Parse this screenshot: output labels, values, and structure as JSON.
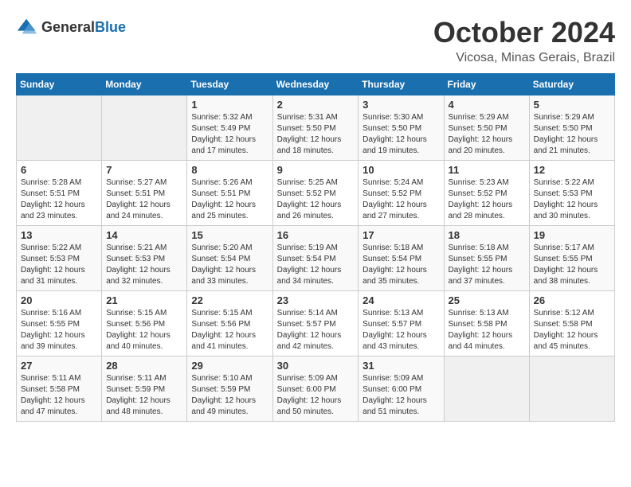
{
  "logo": {
    "general": "General",
    "blue": "Blue"
  },
  "title": {
    "month": "October 2024",
    "location": "Vicosa, Minas Gerais, Brazil"
  },
  "weekdays": [
    "Sunday",
    "Monday",
    "Tuesday",
    "Wednesday",
    "Thursday",
    "Friday",
    "Saturday"
  ],
  "weeks": [
    [
      {
        "day": "",
        "info": ""
      },
      {
        "day": "",
        "info": ""
      },
      {
        "day": "1",
        "info": "Sunrise: 5:32 AM\nSunset: 5:49 PM\nDaylight: 12 hours and 17 minutes."
      },
      {
        "day": "2",
        "info": "Sunrise: 5:31 AM\nSunset: 5:50 PM\nDaylight: 12 hours and 18 minutes."
      },
      {
        "day": "3",
        "info": "Sunrise: 5:30 AM\nSunset: 5:50 PM\nDaylight: 12 hours and 19 minutes."
      },
      {
        "day": "4",
        "info": "Sunrise: 5:29 AM\nSunset: 5:50 PM\nDaylight: 12 hours and 20 minutes."
      },
      {
        "day": "5",
        "info": "Sunrise: 5:29 AM\nSunset: 5:50 PM\nDaylight: 12 hours and 21 minutes."
      }
    ],
    [
      {
        "day": "6",
        "info": "Sunrise: 5:28 AM\nSunset: 5:51 PM\nDaylight: 12 hours and 23 minutes."
      },
      {
        "day": "7",
        "info": "Sunrise: 5:27 AM\nSunset: 5:51 PM\nDaylight: 12 hours and 24 minutes."
      },
      {
        "day": "8",
        "info": "Sunrise: 5:26 AM\nSunset: 5:51 PM\nDaylight: 12 hours and 25 minutes."
      },
      {
        "day": "9",
        "info": "Sunrise: 5:25 AM\nSunset: 5:52 PM\nDaylight: 12 hours and 26 minutes."
      },
      {
        "day": "10",
        "info": "Sunrise: 5:24 AM\nSunset: 5:52 PM\nDaylight: 12 hours and 27 minutes."
      },
      {
        "day": "11",
        "info": "Sunrise: 5:23 AM\nSunset: 5:52 PM\nDaylight: 12 hours and 28 minutes."
      },
      {
        "day": "12",
        "info": "Sunrise: 5:22 AM\nSunset: 5:53 PM\nDaylight: 12 hours and 30 minutes."
      }
    ],
    [
      {
        "day": "13",
        "info": "Sunrise: 5:22 AM\nSunset: 5:53 PM\nDaylight: 12 hours and 31 minutes."
      },
      {
        "day": "14",
        "info": "Sunrise: 5:21 AM\nSunset: 5:53 PM\nDaylight: 12 hours and 32 minutes."
      },
      {
        "day": "15",
        "info": "Sunrise: 5:20 AM\nSunset: 5:54 PM\nDaylight: 12 hours and 33 minutes."
      },
      {
        "day": "16",
        "info": "Sunrise: 5:19 AM\nSunset: 5:54 PM\nDaylight: 12 hours and 34 minutes."
      },
      {
        "day": "17",
        "info": "Sunrise: 5:18 AM\nSunset: 5:54 PM\nDaylight: 12 hours and 35 minutes."
      },
      {
        "day": "18",
        "info": "Sunrise: 5:18 AM\nSunset: 5:55 PM\nDaylight: 12 hours and 37 minutes."
      },
      {
        "day": "19",
        "info": "Sunrise: 5:17 AM\nSunset: 5:55 PM\nDaylight: 12 hours and 38 minutes."
      }
    ],
    [
      {
        "day": "20",
        "info": "Sunrise: 5:16 AM\nSunset: 5:55 PM\nDaylight: 12 hours and 39 minutes."
      },
      {
        "day": "21",
        "info": "Sunrise: 5:15 AM\nSunset: 5:56 PM\nDaylight: 12 hours and 40 minutes."
      },
      {
        "day": "22",
        "info": "Sunrise: 5:15 AM\nSunset: 5:56 PM\nDaylight: 12 hours and 41 minutes."
      },
      {
        "day": "23",
        "info": "Sunrise: 5:14 AM\nSunset: 5:57 PM\nDaylight: 12 hours and 42 minutes."
      },
      {
        "day": "24",
        "info": "Sunrise: 5:13 AM\nSunset: 5:57 PM\nDaylight: 12 hours and 43 minutes."
      },
      {
        "day": "25",
        "info": "Sunrise: 5:13 AM\nSunset: 5:58 PM\nDaylight: 12 hours and 44 minutes."
      },
      {
        "day": "26",
        "info": "Sunrise: 5:12 AM\nSunset: 5:58 PM\nDaylight: 12 hours and 45 minutes."
      }
    ],
    [
      {
        "day": "27",
        "info": "Sunrise: 5:11 AM\nSunset: 5:58 PM\nDaylight: 12 hours and 47 minutes."
      },
      {
        "day": "28",
        "info": "Sunrise: 5:11 AM\nSunset: 5:59 PM\nDaylight: 12 hours and 48 minutes."
      },
      {
        "day": "29",
        "info": "Sunrise: 5:10 AM\nSunset: 5:59 PM\nDaylight: 12 hours and 49 minutes."
      },
      {
        "day": "30",
        "info": "Sunrise: 5:09 AM\nSunset: 6:00 PM\nDaylight: 12 hours and 50 minutes."
      },
      {
        "day": "31",
        "info": "Sunrise: 5:09 AM\nSunset: 6:00 PM\nDaylight: 12 hours and 51 minutes."
      },
      {
        "day": "",
        "info": ""
      },
      {
        "day": "",
        "info": ""
      }
    ]
  ]
}
